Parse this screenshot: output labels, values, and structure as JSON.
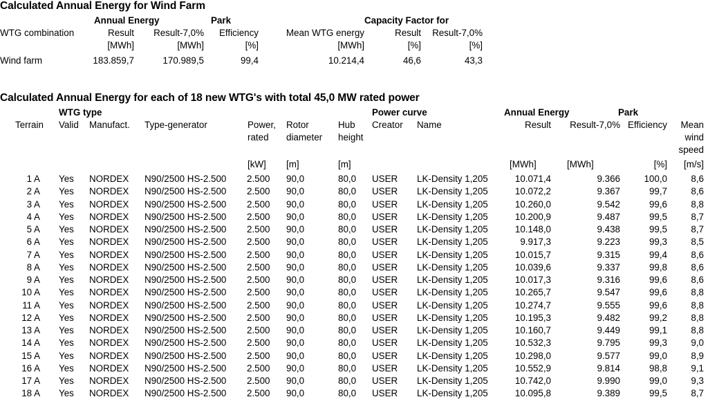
{
  "wind_farm_summary": {
    "title": "Calculated Annual Energy for Wind Farm",
    "group_headers": {
      "annual_energy": "Annual Energy",
      "park": "Park",
      "capacity_factor": "Capacity Factor for"
    },
    "columns": [
      {
        "label": "WTG combination",
        "unit": ""
      },
      {
        "label": "Result",
        "unit": "[MWh]"
      },
      {
        "label": "Result-7,0%",
        "unit": "[MWh]"
      },
      {
        "label": "Efficiency",
        "unit": "[%]"
      },
      {
        "label": "Mean WTG energy",
        "unit": "[MWh]"
      },
      {
        "label": "Result",
        "unit": "[%]"
      },
      {
        "label": "Result-7,0%",
        "unit": "[%]"
      }
    ],
    "rows": [
      {
        "combination": "Wind farm",
        "annual_energy_result": "183.859,7",
        "annual_energy_result_minus_7": "170.989,5",
        "park_efficiency": "99,4",
        "mean_wtg_energy": "10.214,4",
        "capacity_factor_result": "46,6",
        "capacity_factor_result_minus_7": "43,3"
      }
    ]
  },
  "wtg_list": {
    "title": "Calculated Annual Energy for each of 18 new WTG's with total 45,0 MW rated power",
    "group_headers": {
      "wtg_type": "WTG type",
      "power_curve": "Power curve",
      "annual_energy": "Annual Energy",
      "park": "Park"
    },
    "columns": [
      {
        "label": "Terrain",
        "line2": "",
        "line3": "",
        "unit": ""
      },
      {
        "label": "Valid",
        "line2": "",
        "line3": "",
        "unit": ""
      },
      {
        "label": "Manufact.",
        "line2": "",
        "line3": "",
        "unit": ""
      },
      {
        "label": "Type-generator",
        "line2": "",
        "line3": "",
        "unit": ""
      },
      {
        "label": "Power,",
        "line2": "rated",
        "line3": "",
        "unit": "[kW]"
      },
      {
        "label": "Rotor",
        "line2": "diameter",
        "line3": "",
        "unit": "[m]"
      },
      {
        "label": "Hub",
        "line2": "height",
        "line3": "",
        "unit": "[m]"
      },
      {
        "label": "Creator",
        "line2": "",
        "line3": "",
        "unit": ""
      },
      {
        "label": "Name",
        "line2": "",
        "line3": "",
        "unit": ""
      },
      {
        "label": "Result",
        "line2": "",
        "line3": "",
        "unit": "[MWh]"
      },
      {
        "label": "Result-7,0%",
        "line2": "",
        "line3": "",
        "unit": "[MWh]"
      },
      {
        "label": "Efficiency",
        "line2": "",
        "line3": "",
        "unit": "[%]"
      },
      {
        "label": "Mean",
        "line2": "wind",
        "line3": "speed",
        "unit": "[m/s]"
      }
    ],
    "rows": [
      {
        "terrain": "1 A",
        "valid": "Yes",
        "manufact": "NORDEX",
        "type_generator": "N90/2500 HS-2.500",
        "power_rated": "2.500",
        "rotor_diameter": "90,0",
        "hub_height": "80,0",
        "creator": "USER",
        "name": "LK-Density 1,205",
        "result": "10.071,4",
        "result_minus_7": "9.366",
        "efficiency": "100,0",
        "mean_wind_speed": "8,6"
      },
      {
        "terrain": "2 A",
        "valid": "Yes",
        "manufact": "NORDEX",
        "type_generator": "N90/2500 HS-2.500",
        "power_rated": "2.500",
        "rotor_diameter": "90,0",
        "hub_height": "80,0",
        "creator": "USER",
        "name": "LK-Density 1,205",
        "result": "10.072,2",
        "result_minus_7": "9.367",
        "efficiency": "99,7",
        "mean_wind_speed": "8,6"
      },
      {
        "terrain": "3 A",
        "valid": "Yes",
        "manufact": "NORDEX",
        "type_generator": "N90/2500 HS-2.500",
        "power_rated": "2.500",
        "rotor_diameter": "90,0",
        "hub_height": "80,0",
        "creator": "USER",
        "name": "LK-Density 1,205",
        "result": "10.260,0",
        "result_minus_7": "9.542",
        "efficiency": "99,6",
        "mean_wind_speed": "8,8"
      },
      {
        "terrain": "4 A",
        "valid": "Yes",
        "manufact": "NORDEX",
        "type_generator": "N90/2500 HS-2.500",
        "power_rated": "2.500",
        "rotor_diameter": "90,0",
        "hub_height": "80,0",
        "creator": "USER",
        "name": "LK-Density 1,205",
        "result": "10.200,9",
        "result_minus_7": "9.487",
        "efficiency": "99,5",
        "mean_wind_speed": "8,7"
      },
      {
        "terrain": "5 A",
        "valid": "Yes",
        "manufact": "NORDEX",
        "type_generator": "N90/2500 HS-2.500",
        "power_rated": "2.500",
        "rotor_diameter": "90,0",
        "hub_height": "80,0",
        "creator": "USER",
        "name": "LK-Density 1,205",
        "result": "10.148,0",
        "result_minus_7": "9.438",
        "efficiency": "99,5",
        "mean_wind_speed": "8,7"
      },
      {
        "terrain": "6 A",
        "valid": "Yes",
        "manufact": "NORDEX",
        "type_generator": "N90/2500 HS-2.500",
        "power_rated": "2.500",
        "rotor_diameter": "90,0",
        "hub_height": "80,0",
        "creator": "USER",
        "name": "LK-Density 1,205",
        "result": "9.917,3",
        "result_minus_7": "9.223",
        "efficiency": "99,3",
        "mean_wind_speed": "8,5"
      },
      {
        "terrain": "7 A",
        "valid": "Yes",
        "manufact": "NORDEX",
        "type_generator": "N90/2500 HS-2.500",
        "power_rated": "2.500",
        "rotor_diameter": "90,0",
        "hub_height": "80,0",
        "creator": "USER",
        "name": "LK-Density 1,205",
        "result": "10.015,7",
        "result_minus_7": "9.315",
        "efficiency": "99,4",
        "mean_wind_speed": "8,6"
      },
      {
        "terrain": "8 A",
        "valid": "Yes",
        "manufact": "NORDEX",
        "type_generator": "N90/2500 HS-2.500",
        "power_rated": "2.500",
        "rotor_diameter": "90,0",
        "hub_height": "80,0",
        "creator": "USER",
        "name": "LK-Density 1,205",
        "result": "10.039,6",
        "result_minus_7": "9.337",
        "efficiency": "99,8",
        "mean_wind_speed": "8,6"
      },
      {
        "terrain": "9 A",
        "valid": "Yes",
        "manufact": "NORDEX",
        "type_generator": "N90/2500 HS-2.500",
        "power_rated": "2.500",
        "rotor_diameter": "90,0",
        "hub_height": "80,0",
        "creator": "USER",
        "name": "LK-Density 1,205",
        "result": "10.017,3",
        "result_minus_7": "9.316",
        "efficiency": "99,6",
        "mean_wind_speed": "8,6"
      },
      {
        "terrain": "10 A",
        "valid": "Yes",
        "manufact": "NORDEX",
        "type_generator": "N90/2500 HS-2.500",
        "power_rated": "2.500",
        "rotor_diameter": "90,0",
        "hub_height": "80,0",
        "creator": "USER",
        "name": "LK-Density 1,205",
        "result": "10.265,7",
        "result_minus_7": "9.547",
        "efficiency": "99,6",
        "mean_wind_speed": "8,8"
      },
      {
        "terrain": "11 A",
        "valid": "Yes",
        "manufact": "NORDEX",
        "type_generator": "N90/2500 HS-2.500",
        "power_rated": "2.500",
        "rotor_diameter": "90,0",
        "hub_height": "80,0",
        "creator": "USER",
        "name": "LK-Density 1,205",
        "result": "10.274,7",
        "result_minus_7": "9.555",
        "efficiency": "99,6",
        "mean_wind_speed": "8,8"
      },
      {
        "terrain": "12 A",
        "valid": "Yes",
        "manufact": "NORDEX",
        "type_generator": "N90/2500 HS-2.500",
        "power_rated": "2.500",
        "rotor_diameter": "90,0",
        "hub_height": "80,0",
        "creator": "USER",
        "name": "LK-Density 1,205",
        "result": "10.195,3",
        "result_minus_7": "9.482",
        "efficiency": "99,2",
        "mean_wind_speed": "8,8"
      },
      {
        "terrain": "13 A",
        "valid": "Yes",
        "manufact": "NORDEX",
        "type_generator": "N90/2500 HS-2.500",
        "power_rated": "2.500",
        "rotor_diameter": "90,0",
        "hub_height": "80,0",
        "creator": "USER",
        "name": "LK-Density 1,205",
        "result": "10.160,7",
        "result_minus_7": "9.449",
        "efficiency": "99,1",
        "mean_wind_speed": "8,8"
      },
      {
        "terrain": "14 A",
        "valid": "Yes",
        "manufact": "NORDEX",
        "type_generator": "N90/2500 HS-2.500",
        "power_rated": "2.500",
        "rotor_diameter": "90,0",
        "hub_height": "80,0",
        "creator": "USER",
        "name": "LK-Density 1,205",
        "result": "10.532,3",
        "result_minus_7": "9.795",
        "efficiency": "99,3",
        "mean_wind_speed": "9,0"
      },
      {
        "terrain": "15 A",
        "valid": "Yes",
        "manufact": "NORDEX",
        "type_generator": "N90/2500 HS-2.500",
        "power_rated": "2.500",
        "rotor_diameter": "90,0",
        "hub_height": "80,0",
        "creator": "USER",
        "name": "LK-Density 1,205",
        "result": "10.298,0",
        "result_minus_7": "9.577",
        "efficiency": "99,0",
        "mean_wind_speed": "8,9"
      },
      {
        "terrain": "16 A",
        "valid": "Yes",
        "manufact": "NORDEX",
        "type_generator": "N90/2500 HS-2.500",
        "power_rated": "2.500",
        "rotor_diameter": "90,0",
        "hub_height": "80,0",
        "creator": "USER",
        "name": "LK-Density 1,205",
        "result": "10.552,9",
        "result_minus_7": "9.814",
        "efficiency": "98,8",
        "mean_wind_speed": "9,1"
      },
      {
        "terrain": "17 A",
        "valid": "Yes",
        "manufact": "NORDEX",
        "type_generator": "N90/2500 HS-2.500",
        "power_rated": "2.500",
        "rotor_diameter": "90,0",
        "hub_height": "80,0",
        "creator": "USER",
        "name": "LK-Density 1,205",
        "result": "10.742,0",
        "result_minus_7": "9.990",
        "efficiency": "99,0",
        "mean_wind_speed": "9,3"
      },
      {
        "terrain": "18 A",
        "valid": "Yes",
        "manufact": "NORDEX",
        "type_generator": "N90/2500 HS-2.500",
        "power_rated": "2.500",
        "rotor_diameter": "90,0",
        "hub_height": "80,0",
        "creator": "USER",
        "name": "LK-Density 1,205",
        "result": "10.095,8",
        "result_minus_7": "9.389",
        "efficiency": "99,5",
        "mean_wind_speed": "8,7"
      }
    ]
  }
}
